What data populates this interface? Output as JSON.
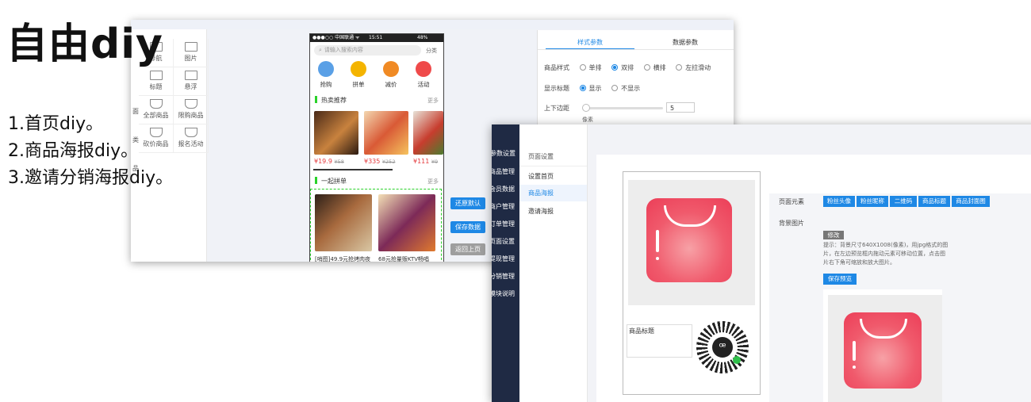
{
  "heading": "自由diy",
  "features": [
    "1.首页diy。",
    "2.商品海报diy。",
    "3.邀请分销海报diy。"
  ],
  "shot1": {
    "components": [
      "导航",
      "图片",
      "标题",
      "悬浮",
      "全部商品",
      "限购商品",
      "砍价商品",
      "报名活动"
    ],
    "partial_labels": [
      "面",
      "类",
      "品"
    ],
    "phone": {
      "status_left": "●●●○○ 中国联通 ᯤ",
      "status_time": "15:51",
      "status_right": "48%",
      "search_placeholder": "请输入搜索内容",
      "search_action": "分类",
      "quick_icons": [
        {
          "label": "抢购",
          "color": "#5aa0e6"
        },
        {
          "label": "拼单",
          "color": "#f4b400"
        },
        {
          "label": "减价",
          "color": "#f08a24"
        },
        {
          "label": "活动",
          "color": "#ef4a4a"
        }
      ],
      "section1": "热卖推荐",
      "section2": "一起拼单",
      "more": "更多",
      "prices": [
        {
          "now": "¥19.9",
          "old": "¥58"
        },
        {
          "now": "¥335",
          "old": "¥252"
        },
        {
          "now": "¥111",
          "old": "¥9"
        }
      ],
      "group_items": [
        "[哨图]49.9元抢烤肉夜",
        "68元抢量贩KTV畅唱"
      ]
    },
    "buttons": [
      {
        "label": "还原默认",
        "color": "#1e88e5"
      },
      {
        "label": "保存数据",
        "color": "#1e88e5"
      },
      {
        "label": "返回上页",
        "color": "#9e9e9e"
      }
    ],
    "settings": {
      "tabs": [
        "样式参数",
        "数据参数"
      ],
      "style_label": "商品样式",
      "style_options": [
        "单排",
        "双排",
        "横排",
        "左拉滑动"
      ],
      "title_label": "显示标题",
      "title_options": [
        "显示",
        "不显示"
      ],
      "margin_label": "上下边距",
      "margin_value": "5",
      "unit": "像素"
    }
  },
  "shot2": {
    "nav": [
      "参数设置",
      "商品管理",
      "会员数据",
      "商户管理",
      "订单管理",
      "页面设置",
      "提现管理",
      "分销管理",
      "模块说明"
    ],
    "sub_title": "页面设置",
    "sub_items": [
      "设置首页",
      "商品海报",
      "邀请海报"
    ],
    "poster_title": "商品标题",
    "element_label": "页面元素",
    "elements": [
      "粉丝头像",
      "粉丝昵称",
      "二维码",
      "商品标题",
      "商品封面图"
    ],
    "bg_label": "背景图片",
    "modify": "修改",
    "hint": [
      "提示：背景尺寸640X1008(像素)，用jpg格式的图",
      "片，在左边预览框内拖动元素可移动位置，点击图",
      "片右下角可缩放和放大图片。"
    ],
    "save": "保存预览"
  }
}
